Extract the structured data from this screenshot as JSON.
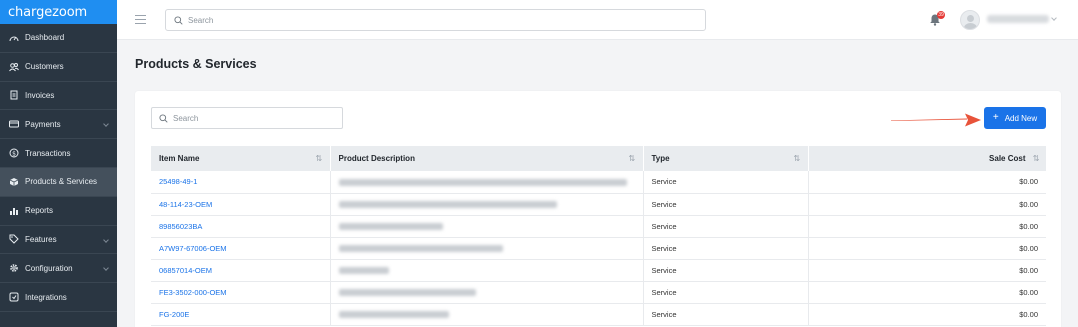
{
  "app": {
    "logo_text": "chargezoom"
  },
  "sidebar": {
    "items": [
      {
        "label": "Dashboard",
        "icon": "dashboard-icon"
      },
      {
        "label": "Customers",
        "icon": "users-icon"
      },
      {
        "label": "Invoices",
        "icon": "invoice-icon"
      },
      {
        "label": "Payments",
        "icon": "credit-card-icon"
      },
      {
        "label": "Transactions",
        "icon": "dollar-circle-icon"
      },
      {
        "label": "Products & Services",
        "icon": "cube-icon"
      },
      {
        "label": "Reports",
        "icon": "bar-chart-icon"
      },
      {
        "label": "Features",
        "icon": "tag-icon"
      },
      {
        "label": "Configuration",
        "icon": "gear-icon"
      },
      {
        "label": "Integrations",
        "icon": "integration-icon"
      }
    ]
  },
  "topbar": {
    "search_placeholder": "Search",
    "notification_count": "39"
  },
  "page": {
    "title": "Products & Services"
  },
  "toolbar": {
    "search_placeholder": "Search",
    "add_label": "Add New"
  },
  "table": {
    "headers": {
      "item_name": "Item Name",
      "description": "Product Description",
      "type": "Type",
      "sale_cost": "Sale Cost"
    },
    "rows": [
      {
        "item": "25498-49-1",
        "type": "Service",
        "cost": "$0.00"
      },
      {
        "item": "48-114-23-OEM",
        "type": "Service",
        "cost": "$0.00"
      },
      {
        "item": "89856023BA",
        "type": "Service",
        "cost": "$0.00"
      },
      {
        "item": "A7W97-67006-OEM",
        "type": "Service",
        "cost": "$0.00"
      },
      {
        "item": "06857014-OEM",
        "type": "Service",
        "cost": "$0.00"
      },
      {
        "item": "FE3-3502-000-OEM",
        "type": "Service",
        "cost": "$0.00"
      },
      {
        "item": "FG-200E",
        "type": "Service",
        "cost": "$0.00"
      }
    ]
  },
  "colors": {
    "sidebar_bg": "#2a3642",
    "brand_blue": "#1f8ef1",
    "button_blue": "#1a73e8",
    "arrow_red": "#e8533a",
    "badge_red": "#e53935"
  }
}
